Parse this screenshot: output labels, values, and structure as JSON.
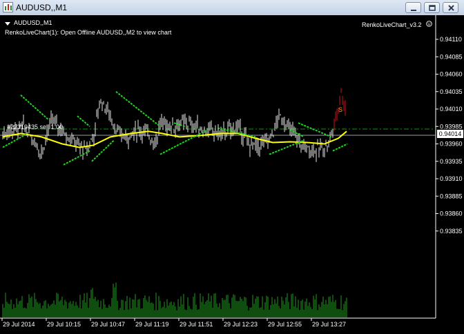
{
  "window": {
    "title": "AUDUSD,,M1"
  },
  "chart": {
    "symbol_label": "AUDUSD,,M1",
    "info_text": "RenkoLiveChart(1): Open Offline AUDUSD,,M2 to view chart",
    "indicator_label": "RenkoLiveChart_v3.2",
    "order_label": "#22319435 sell 1.00",
    "sell_marker": "S",
    "current_price": "0.94014",
    "price_axis": [
      "0.94110",
      "0.94085",
      "0.94060",
      "0.94035",
      "0.94010",
      "0.93985",
      "0.93960",
      "0.93935",
      "0.93910",
      "0.93885",
      "0.93860",
      "0.93835"
    ],
    "time_axis": [
      "29 Jul 2014",
      "29 Jul 10:15",
      "29 Jul 10:47",
      "29 Jul 11:19",
      "29 Jul 11:51",
      "29 Jul 12:23",
      "29 Jul 12:55",
      "29 Jul 13:27"
    ],
    "colors": {
      "background": "#000000",
      "candle": "#e8e8e8",
      "candle_red": "#c8141e",
      "moving_average": "#ffff00",
      "bands": "#21d421",
      "volume": "#1e9c1e",
      "order_line": "#0d9a0d",
      "axis": "#ffffff",
      "sell_marker": "#ffa500"
    }
  }
}
